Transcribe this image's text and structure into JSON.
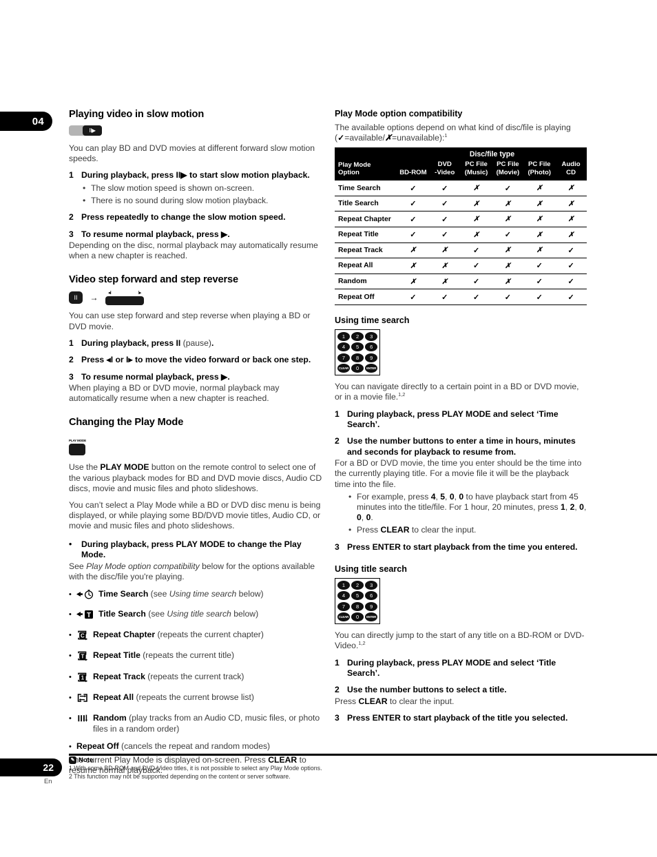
{
  "chapter_tab": "04",
  "left_column": {
    "slow_motion": {
      "heading": "Playing video in slow motion",
      "button_label": "II▶",
      "intro": "You can play BD and DVD movies at different forward slow motion speeds.",
      "steps": [
        {
          "num": "1",
          "bold_before": "During playback, press ",
          "glyph": "II▶",
          "bold_after": " to start slow motion playback.",
          "substeps": [
            "The slow motion speed is shown on-screen.",
            "There is no sound during slow motion playback."
          ]
        },
        {
          "num": "2",
          "bold": "Press repeatedly to change the slow motion speed.",
          "substeps": []
        },
        {
          "num": "3",
          "bold": "To resume normal playback, press ▶.",
          "after": "Depending on the disc, normal playback may automatically resume when a new chapter is reached.",
          "substeps": []
        }
      ]
    },
    "step_forward": {
      "heading": "Video step forward and step reverse",
      "pause_glyph": "II",
      "arrow": "→",
      "tick_left": "◂I",
      "tick_right": "I▸",
      "intro": "You can use step forward and step reverse when playing a BD or DVD movie.",
      "steps": [
        {
          "num": "1",
          "bold": "During playback, press II",
          "reg": " (pause)",
          "bold_tail": "."
        },
        {
          "num": "2",
          "bold": "Press ◂I or I▸ to move the video forward or back one step."
        },
        {
          "num": "3",
          "bold": "To resume normal playback, press ▶.",
          "after": "When playing a BD or DVD movie, normal playback may automatically resume when a new chapter is reached."
        }
      ]
    },
    "play_mode": {
      "heading": "Changing the Play Mode",
      "button_caption": "PLAY MODE",
      "para1_a": "Use the ",
      "para1_b": "PLAY MODE",
      "para1_c": " button on the remote control to select one of the various playback modes for BD and DVD movie discs, Audio CD discs, movie and music files and photo slideshows.",
      "para2": "You can’t select a Play Mode while a BD or DVD disc menu is being displayed, or while playing some BD/DVD movie titles, Audio CD, or movie and music files and photo slideshows.",
      "bullet_step": "During playback, press PLAY MODE to change the Play Mode.",
      "see_a": "See ",
      "see_italic": "Play Mode option compatibility",
      "see_b": " below for the options available with the disc/file you're playing.",
      "options": [
        {
          "icon": "time-search-icon",
          "label": "Time Search",
          "note_a": " (see ",
          "note_italic": "Using time search",
          "note_b": " below)"
        },
        {
          "icon": "title-search-icon",
          "label": "Title Search",
          "note_a": " (see ",
          "note_italic": "Using title search",
          "note_b": " below)"
        },
        {
          "icon": "repeat-chapter-icon",
          "label": "Repeat Chapter",
          "note_a": " (repeats the current chapter)",
          "note_italic": "",
          "note_b": ""
        },
        {
          "icon": "repeat-title-icon",
          "label": "Repeat Title",
          "note_a": " (repeats the current title)",
          "note_italic": "",
          "note_b": ""
        },
        {
          "icon": "repeat-track-icon",
          "label": "Repeat Track",
          "note_a": " (repeats the current track)",
          "note_italic": "",
          "note_b": ""
        },
        {
          "icon": "repeat-all-icon",
          "label": "Repeat All",
          "note_a": " (repeats the current browse list)",
          "note_italic": "",
          "note_b": ""
        },
        {
          "icon": "random-icon",
          "label": "Random",
          "note_a": " (play tracks from an Audio CD, music files, or photo files in a random order)",
          "note_italic": "",
          "note_b": ""
        },
        {
          "icon": "",
          "label": "Repeat Off",
          "note_a": " (cancels the repeat and random modes)",
          "note_italic": "",
          "note_b": ""
        }
      ],
      "closing_a": "The current Play Mode is displayed on-screen. Press ",
      "closing_bold": "CLEAR",
      "closing_b": " to resume normal playback."
    }
  },
  "right_column": {
    "compat": {
      "heading": "Play Mode option compatibility",
      "intro_a": "The available options depend on what kind of disc/file is playing (",
      "intro_check": "✓",
      "intro_mid": "=available/",
      "intro_x": "✗",
      "intro_b": "=unavailable):",
      "intro_sup": "1"
    },
    "chart_data": {
      "type": "table",
      "title": "Play Mode option compatibility",
      "group_header": "Disc/file type",
      "row_header_label": "Play Mode\nOption",
      "row_header_line1": "Play Mode",
      "row_header_line2": "Option",
      "categories": [
        "BD-ROM",
        "DVD -Video",
        "PC File (Music)",
        "PC File (Movie)",
        "PC File (Photo)",
        "Audio CD"
      ],
      "column_headers": [
        {
          "line1": "BD-ROM",
          "line2": ""
        },
        {
          "line1": "DVD",
          "line2": "-Video"
        },
        {
          "line1": "PC File",
          "line2": "(Music)"
        },
        {
          "line1": "PC File",
          "line2": "(Movie)"
        },
        {
          "line1": "PC File",
          "line2": "(Photo)"
        },
        {
          "line1": "Audio",
          "line2": "CD"
        }
      ],
      "rows": [
        {
          "label": "Time Search",
          "values": [
            "✓",
            "✓",
            "✗",
            "✓",
            "✗",
            "✗"
          ]
        },
        {
          "label": "Title Search",
          "values": [
            "✓",
            "✓",
            "✗",
            "✗",
            "✗",
            "✗"
          ]
        },
        {
          "label": "Repeat Chapter",
          "values": [
            "✓",
            "✓",
            "✗",
            "✗",
            "✗",
            "✗"
          ]
        },
        {
          "label": "Repeat Title",
          "values": [
            "✓",
            "✓",
            "✗",
            "✓",
            "✗",
            "✗"
          ]
        },
        {
          "label": "Repeat Track",
          "values": [
            "✗",
            "✗",
            "✓",
            "✗",
            "✗",
            "✓"
          ]
        },
        {
          "label": "Repeat All",
          "values": [
            "✗",
            "✗",
            "✓",
            "✗",
            "✓",
            "✓"
          ]
        },
        {
          "label": "Random",
          "values": [
            "✗",
            "✗",
            "✓",
            "✗",
            "✓",
            "✓"
          ]
        },
        {
          "label": "Repeat Off",
          "values": [
            "✓",
            "✓",
            "✓",
            "✓",
            "✓",
            "✓"
          ]
        }
      ],
      "legend": {
        "available": "✓ = available",
        "unavailable": "✗ = unavailable"
      }
    },
    "time_search": {
      "heading": "Using time search",
      "keypad": [
        "1",
        "2",
        "3",
        "4",
        "5",
        "6",
        "7",
        "8",
        "9",
        "CLEAR",
        "0",
        "ENTER"
      ],
      "intro": "You can navigate directly to a certain point in a BD or DVD movie, or in a movie file.",
      "intro_sup": "1,2",
      "steps": [
        {
          "num": "1",
          "bold": "During playback, press PLAY MODE and select ‘Time Search’."
        },
        {
          "num": "2",
          "bold": "Use the number buttons to enter a time in hours, minutes and seconds for playback to resume from.",
          "after": "For a BD or DVD movie, the time you enter should be the time into the currently playing title. For a movie file it will be the playback time into the file.",
          "substeps": [
            {
              "a": "For example, press ",
              "b1": "4",
              "b2": "5",
              "b3": "0",
              "b4": "0",
              "c": " to have playback start from 45 minutes into the title/file. For 1 hour, 20 minutes, press ",
              "d1": "1",
              "d2": "2",
              "d3": "0",
              "d4": "0",
              "d5": "0",
              "e": "."
            },
            {
              "plain_a": "Press ",
              "plain_b": "CLEAR",
              "plain_c": " to clear the input."
            }
          ]
        },
        {
          "num": "3",
          "bold": "Press ENTER to start playback from the time you entered."
        }
      ]
    },
    "title_search": {
      "heading": "Using title search",
      "keypad": [
        "1",
        "2",
        "3",
        "4",
        "5",
        "6",
        "7",
        "8",
        "9",
        "CLEAR",
        "0",
        "ENTER"
      ],
      "intro": "You can directly jump to the start of any title on a BD-ROM or DVD-Video.",
      "intro_sup": "1,2",
      "steps": [
        {
          "num": "1",
          "bold": "During playback, press PLAY MODE and select ‘Title Search’."
        },
        {
          "num": "2",
          "bold": "Use the number buttons to select a title.",
          "after_a": "Press ",
          "after_bold": "CLEAR",
          "after_b": " to clear the input."
        },
        {
          "num": "3",
          "bold": "Press ENTER to start playback of the title you selected."
        }
      ]
    }
  },
  "footer": {
    "page_number": "22",
    "language": "En",
    "note_title": "Note",
    "notes": [
      "1 With some BD-ROM and DVD-Video titles, it is not possible to select any Play Mode options.",
      "2 This function may not be supported depending on the content or server software."
    ]
  }
}
